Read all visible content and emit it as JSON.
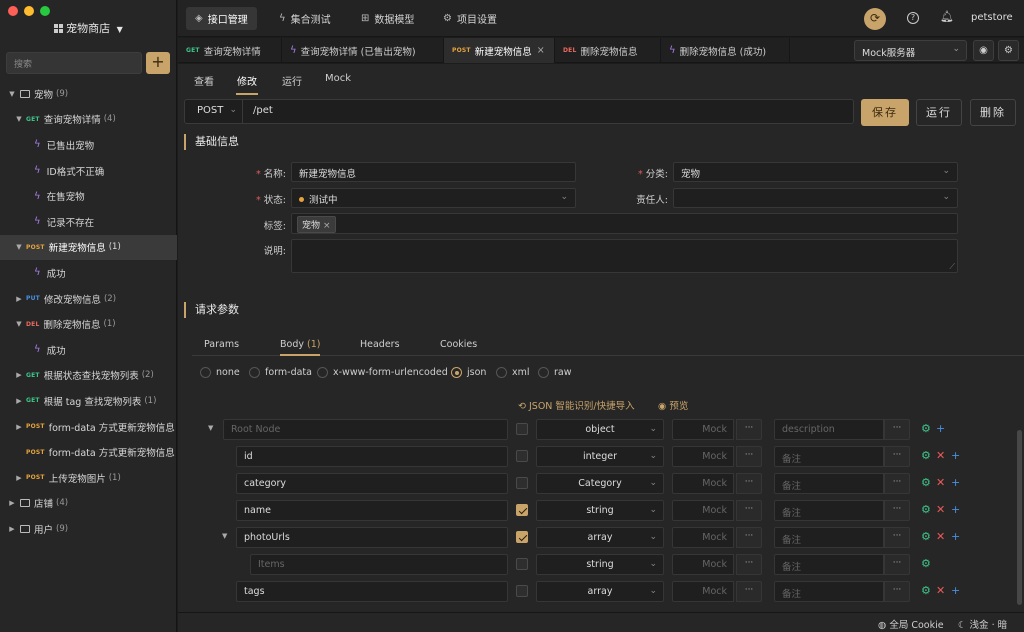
{
  "sidebar": {
    "project_name": "宠物商店",
    "search_placeholder": "搜索",
    "add_label": "+",
    "tree": [
      {
        "kind": "folder",
        "name": "宠物",
        "count": "(9)"
      },
      {
        "kind": "api",
        "method": "GET",
        "name": "查询宠物详情",
        "count": "(4)"
      },
      {
        "kind": "case",
        "name": "已售出宠物"
      },
      {
        "kind": "case",
        "name": "ID格式不正确"
      },
      {
        "kind": "case",
        "name": "在售宠物"
      },
      {
        "kind": "case",
        "name": "记录不存在"
      },
      {
        "kind": "api",
        "method": "POST",
        "name": "新建宠物信息",
        "count": "(1)"
      },
      {
        "kind": "case",
        "name": "成功"
      },
      {
        "kind": "api",
        "method": "PUT",
        "name": "修改宠物信息",
        "count": "(2)"
      },
      {
        "kind": "api",
        "method": "DEL",
        "name": "删除宠物信息",
        "count": "(1)"
      },
      {
        "kind": "case",
        "name": "成功"
      },
      {
        "kind": "api",
        "method": "GET",
        "name": "根据状态查找宠物列表",
        "count": "(2)"
      },
      {
        "kind": "api",
        "method": "GET",
        "name": "根据 tag 查找宠物列表",
        "count": "(1)"
      },
      {
        "kind": "api",
        "method": "POST",
        "name": "form-data 方式更新宠物信息",
        "count": ""
      },
      {
        "kind": "api",
        "method": "POST",
        "name": "form-data 方式更新宠物信息",
        "count": ""
      },
      {
        "kind": "api",
        "method": "POST",
        "name": "上传宠物图片",
        "count": "(1)"
      },
      {
        "kind": "folder",
        "name": "店铺",
        "count": "(4)"
      },
      {
        "kind": "folder",
        "name": "用户",
        "count": "(9)"
      }
    ]
  },
  "topnav": {
    "items": [
      "接口管理",
      "集合测试",
      "数据模型",
      "项目设置"
    ],
    "user": "petstore"
  },
  "tabs": [
    {
      "method": "GET",
      "label": "查询宠物详情"
    },
    {
      "method": "",
      "label": "查询宠物详情 (已售出宠物)"
    },
    {
      "method": "POST",
      "label": "新建宠物信息"
    },
    {
      "method": "DEL",
      "label": "删除宠物信息"
    },
    {
      "method": "",
      "label": "删除宠物信息 (成功)"
    }
  ],
  "mock_server": "Mock服务器",
  "subtabs": [
    "查看",
    "修改",
    "运行",
    "Mock"
  ],
  "request": {
    "method": "POST",
    "path": "/pet",
    "save": "保存",
    "run": "运行",
    "delete": "删除"
  },
  "basic": {
    "title": "基础信息",
    "name_label": "名称:",
    "name_value": "新建宠物信息",
    "category_label": "分类:",
    "category_value": "宠物",
    "status_label": "状态:",
    "status_value": "测试中",
    "owner_label": "责任人:",
    "tags_label": "标签:",
    "tag_value": "宠物",
    "desc_label": "说明:"
  },
  "params": {
    "title": "请求参数",
    "tabs": [
      "Params",
      "Body",
      "Headers",
      "Cookies"
    ],
    "body_count": "(1)",
    "body_types": [
      "none",
      "form-data",
      "x-www-form-urlencoded",
      "json",
      "xml",
      "raw"
    ],
    "json_import": "JSON 智能识别/快捷导入",
    "preview": "预览"
  },
  "schema": {
    "rows": [
      {
        "name": "Root Node",
        "placeholder": true,
        "type": "object",
        "mock": "Mock",
        "desc": "description",
        "required": false
      },
      {
        "name": "id",
        "placeholder": false,
        "type": "integer",
        "mock": "Mock",
        "desc": "备注",
        "required": false
      },
      {
        "name": "category",
        "placeholder": false,
        "type": "Category",
        "mock": "Mock",
        "desc": "备注",
        "required": false
      },
      {
        "name": "name",
        "placeholder": false,
        "type": "string",
        "mock": "Mock",
        "desc": "备注",
        "required": true
      },
      {
        "name": "photoUrls",
        "placeholder": false,
        "type": "array",
        "mock": "Mock",
        "desc": "备注",
        "required": true
      },
      {
        "name": "Items",
        "placeholder": true,
        "type": "string",
        "mock": "Mock",
        "desc": "备注",
        "required": false
      },
      {
        "name": "tags",
        "placeholder": false,
        "type": "array",
        "mock": "Mock",
        "desc": "备注",
        "required": false
      }
    ]
  },
  "status": {
    "cookie": "全局 Cookie",
    "theme": "浅金 · 暗"
  },
  "colors": {
    "accent": "#c9a46a",
    "get": "#3ec58a",
    "post": "#e5a33d",
    "put": "#4a90e2",
    "del": "#ec6a5e"
  }
}
